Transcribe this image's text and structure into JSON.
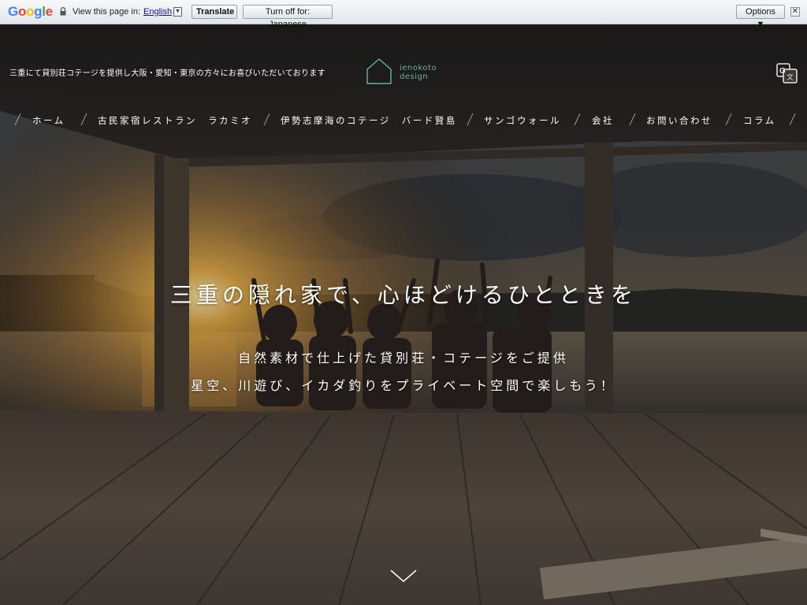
{
  "translate_bar": {
    "logo": "Google",
    "view_prefix": "View this page in:",
    "language": "English",
    "translate_label": "Translate",
    "turn_off_label": "Turn off for: Japanese",
    "options_label": "Options ▼",
    "close_glyph": "✕"
  },
  "site": {
    "tagline": "三重にて貸別荘コテージを提供し大阪・愛知・東京の方々にお喜びいただいております",
    "logo_line1": "ienokoto",
    "logo_line2": "design"
  },
  "nav": {
    "items": [
      {
        "label": "ホーム"
      },
      {
        "label": "古民家宿レストラン　ラカミオ"
      },
      {
        "label": "伊勢志摩海のコテージ　バード賢島"
      },
      {
        "label": "サンゴウォール"
      },
      {
        "label": "会社"
      },
      {
        "label": "お問い合わせ"
      },
      {
        "label": "コラム"
      }
    ]
  },
  "hero": {
    "headline": "三重の隠れ家で、心ほどけるひとときを",
    "sub1": "自然素材で仕上げた貸別荘・コテージをご提供",
    "sub2": "星空、川遊び、イカダ釣りをプライベート空間で楽しもう！"
  },
  "colors": {
    "logo_teal": "#5fb3a6",
    "text": "#ffffff"
  },
  "icons": [
    "lock-icon",
    "dropdown-icon",
    "close-icon",
    "house-logo-icon",
    "google-translate-icon",
    "chevron-down-icon"
  ]
}
